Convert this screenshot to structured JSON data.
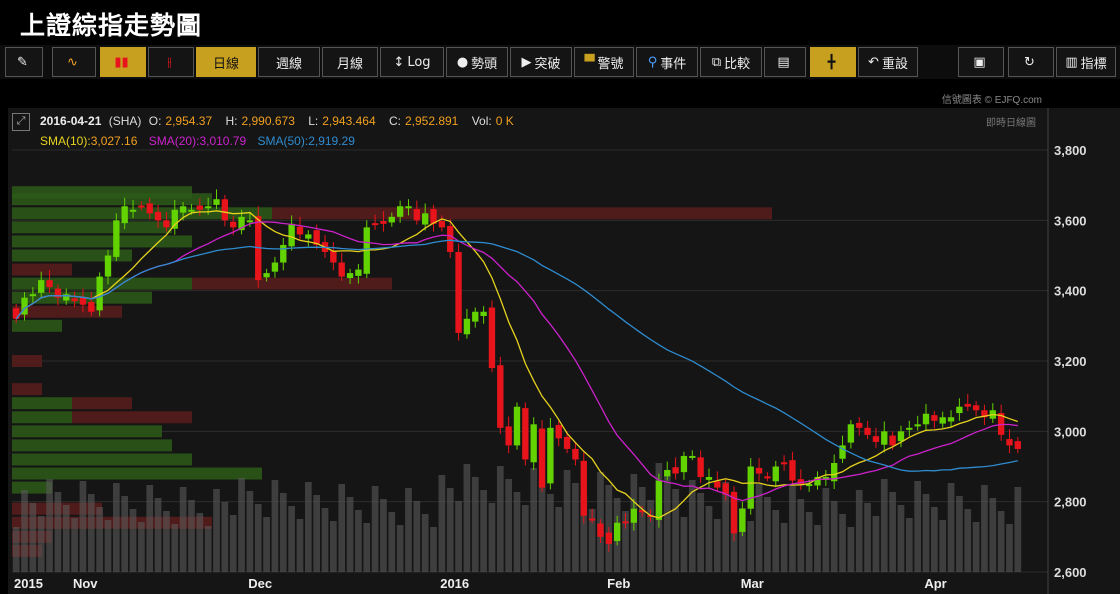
{
  "page": {
    "title": "上證綜指走勢圖"
  },
  "toolbar": {
    "items": [
      {
        "label": "",
        "icon": "pencil-icon"
      },
      {
        "label": "",
        "icon": "line-chart-icon"
      },
      {
        "label": "",
        "icon": "candlestick-icon",
        "active": true
      },
      {
        "label": "",
        "icon": "ohlc-bar-icon"
      },
      {
        "label": "日線",
        "active": true
      },
      {
        "label": "週線"
      },
      {
        "label": "月線"
      },
      {
        "label": "Log",
        "icon": "vertical-arrows-icon"
      },
      {
        "label": "勢頭",
        "icon": "circle-icon"
      },
      {
        "label": "突破",
        "icon": "play-icon"
      },
      {
        "label": "警號",
        "icon": "flag-icon"
      },
      {
        "label": "事件",
        "icon": "pin-icon"
      },
      {
        "label": "比較",
        "icon": "compare-icon"
      },
      {
        "label": "",
        "icon": "document-icon"
      },
      {
        "label": "",
        "icon": "crosshair-icon",
        "active": true
      },
      {
        "label": "重設",
        "icon": "undo-icon"
      },
      {
        "label": "",
        "icon": "save-icon"
      },
      {
        "label": "",
        "icon": "refresh-icon"
      },
      {
        "label": "指標",
        "icon": "indicator-icon"
      }
    ]
  },
  "watermark": {
    "brand": "信號圖表 © EJFQ.com",
    "mode": "即時日線圖"
  },
  "quote": {
    "date": "2016-04-21",
    "symbol": "(SHA)",
    "o_label": "O:",
    "o": "2,954.37",
    "h_label": "H:",
    "h": "2,990.673",
    "l_label": "L:",
    "l": "2,943.464",
    "c_label": "C:",
    "c": "2,952.891",
    "vol_label": "Vol:",
    "vol": "0 K"
  },
  "sma": {
    "sma10_label": "SMA(10):",
    "sma10": "3,027.16",
    "sma20_label": "SMA(20):",
    "sma20": "3,010.79",
    "sma50_label": "SMA(50):",
    "sma50": "2,919.29"
  },
  "colors": {
    "up": "#62d200",
    "down": "#e8141b",
    "sma10": "#e6d21e",
    "sma20": "#cc22cc",
    "sma50": "#2f8ccf",
    "bg": "#151515",
    "grid": "#2c2c2c",
    "volume": "#5a5a5a",
    "quote_value": "#f0a020"
  },
  "chart_data": {
    "type": "candlestick",
    "ylim": [
      2600,
      3800
    ],
    "y_ticks": [
      "3,800",
      "3,600",
      "3,400",
      "3,200",
      "3,000",
      "2,800",
      "2,600"
    ],
    "y_tick_values": [
      3800,
      3600,
      3400,
      3200,
      3000,
      2800,
      2600
    ],
    "x_labels": [
      {
        "label": "2015",
        "index": 0
      },
      {
        "label": "Nov",
        "index": 8
      },
      {
        "label": "Dec",
        "index": 29
      },
      {
        "label": "2016",
        "index": 52
      },
      {
        "label": "Feb",
        "index": 72
      },
      {
        "label": "Mar",
        "index": 88
      },
      {
        "label": "Apr",
        "index": 110
      }
    ],
    "close": [
      3320,
      3380,
      3390,
      3430,
      3410,
      3380,
      3390,
      3370,
      3360,
      3340,
      3440,
      3500,
      3600,
      3640,
      3630,
      3640,
      3620,
      3600,
      3580,
      3630,
      3640,
      3630,
      3630,
      3640,
      3660,
      3600,
      3580,
      3610,
      3600,
      3430,
      3450,
      3480,
      3530,
      3590,
      3560,
      3560,
      3530,
      3510,
      3480,
      3440,
      3450,
      3460,
      3580,
      3590,
      3590,
      3610,
      3640,
      3640,
      3600,
      3620,
      3590,
      3580,
      3510,
      3280,
      3320,
      3340,
      3340,
      3180,
      3010,
      2960,
      3070,
      2920,
      3020,
      2840,
      3010,
      2980,
      2950,
      2920,
      2760,
      2750,
      2700,
      2680,
      2740,
      2740,
      2780,
      2770,
      2760,
      2860,
      2890,
      2880,
      2930,
      2930,
      2870,
      2870,
      2840,
      2820,
      2710,
      2780,
      2900,
      2880,
      2870,
      2900,
      2910,
      2860,
      2850,
      2850,
      2870,
      2870,
      2910,
      2960,
      3020,
      3010,
      2990,
      2970,
      3000,
      2960,
      3000,
      3010,
      3020,
      3050,
      3030,
      3040,
      3040,
      3070,
      3070,
      3060,
      3040,
      3060,
      2990,
      2960,
      2950
    ],
    "candle_count": 121,
    "last_values": {
      "sma10": 3027.16,
      "sma20": 3010.79,
      "sma50": 2919.29
    }
  }
}
